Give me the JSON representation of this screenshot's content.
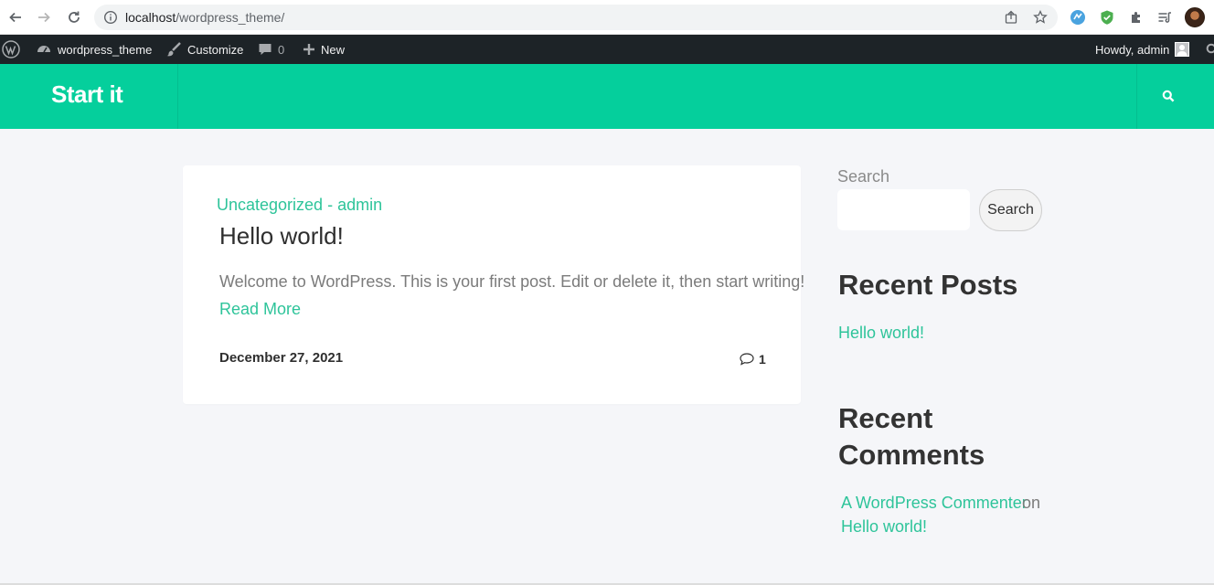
{
  "browser": {
    "url_host": "localhost",
    "url_path": "/wordpress_theme/"
  },
  "adminbar": {
    "site_name": "wordpress_theme",
    "customize": "Customize",
    "comments_count": "0",
    "new_label": "New",
    "howdy": "Howdy, admin"
  },
  "header": {
    "logo_text": "Start it"
  },
  "post": {
    "meta": "Uncategorized - admin",
    "title": "Hello world!",
    "excerpt": "Welcome to WordPress. This is your first post. Edit or delete it, then start writing!",
    "read_more": "Read More",
    "date": "December 27, 2021",
    "comments": "1"
  },
  "sidebar": {
    "search_label": "Search",
    "search_button": "Search",
    "recent_posts_heading": "Recent Posts",
    "recent_posts": [
      "Hello world!"
    ],
    "recent_comments_heading_line1": "Recent",
    "recent_comments_heading_line2": "Comments",
    "comment_author": "A WordPress Commenter",
    "comment_on": "on",
    "comment_post": "Hello world!"
  },
  "colors": {
    "accent": "#05cf9c",
    "link": "#2ec49a",
    "adminbar": "#1d2327"
  }
}
